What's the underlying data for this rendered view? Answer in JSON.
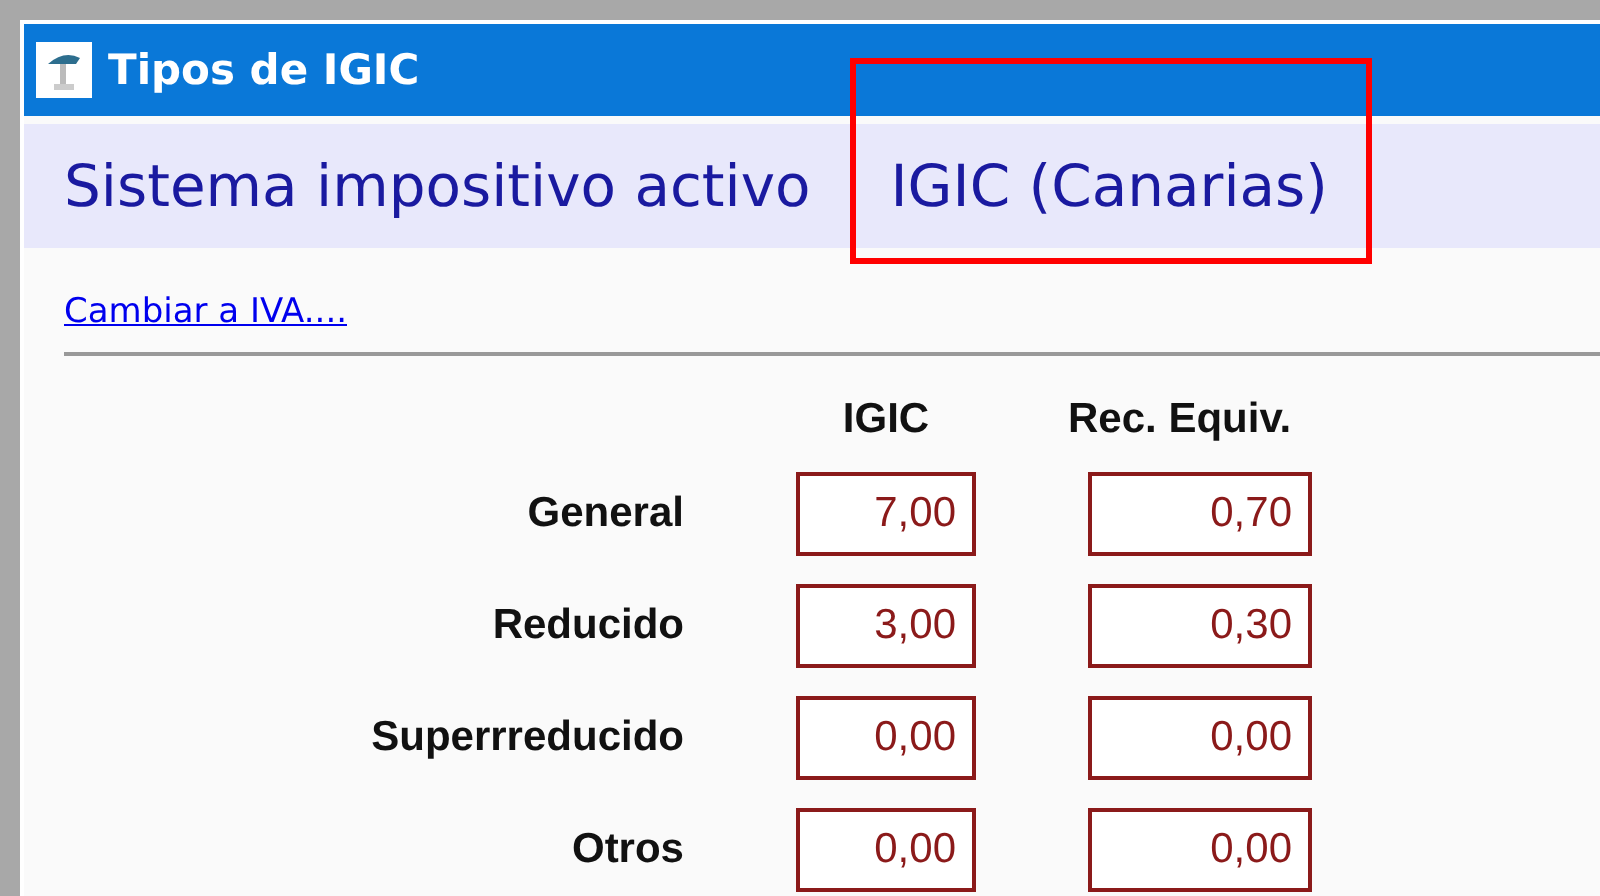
{
  "window": {
    "title": "Tipos de IGIC"
  },
  "header": {
    "label": "Sistema impositivo activo",
    "value": "IGIC (Canarias)"
  },
  "link": "Cambiar a IVA....",
  "table": {
    "columns": [
      "IGIC",
      "Rec. Equiv."
    ],
    "rows": [
      {
        "label": "General",
        "values": [
          "7,00",
          "0,70"
        ]
      },
      {
        "label": "Reducido",
        "values": [
          "3,00",
          "0,30"
        ]
      },
      {
        "label": "Superrreducido",
        "values": [
          "0,00",
          "0,00"
        ]
      },
      {
        "label": "Otros",
        "values": [
          "0,00",
          "0,00"
        ]
      }
    ]
  }
}
